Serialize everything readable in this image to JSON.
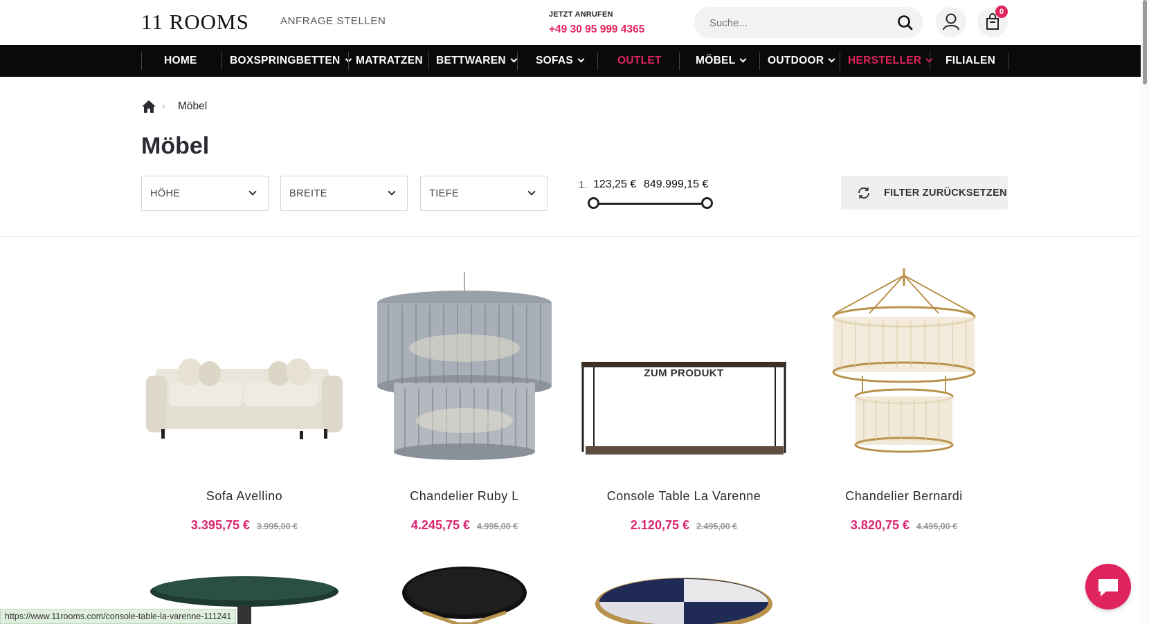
{
  "header": {
    "logo": "11 ROOMS",
    "anfrage": "ANFRAGE STELLEN",
    "call_label": "JETZT ANRUFEN",
    "call_number": "+49 30 95 999 4365",
    "search_placeholder": "Suche...",
    "cart_count": "0"
  },
  "nav": {
    "items": [
      {
        "label": "HOME"
      },
      {
        "label": "BOXSPRINGBETTEN"
      },
      {
        "label": "MATRATZEN"
      },
      {
        "label": "BETTWAREN"
      },
      {
        "label": "SOFAS"
      },
      {
        "label": "OUTLET"
      },
      {
        "label": "MÖBEL"
      },
      {
        "label": "OUTDOOR"
      },
      {
        "label": "HERSTELLER"
      },
      {
        "label": "FILIALEN"
      }
    ]
  },
  "breadcrumb": {
    "sep": "›",
    "current": "Möbel"
  },
  "page_title": "Möbel",
  "filters": {
    "hoehe": "HÖHE",
    "breite": "BREITE",
    "tiefe": "TIEFE",
    "price_prefix": "1.",
    "price_min": "123,25 €",
    "price_max": "849.999,15 €",
    "reset": "FILTER ZURÜCKSETZEN"
  },
  "products": [
    {
      "name": "Sofa Avellino",
      "price": "3.395,75 €",
      "old_price": "3.995,00 €"
    },
    {
      "name": "Chandelier Ruby L",
      "price": "4.245,75 €",
      "old_price": "4.995,00 €"
    },
    {
      "name": "Console Table La Varenne",
      "price": "2.120,75 €",
      "old_price": "2.495,00 €",
      "overlay": "ZUM PRODUKT"
    },
    {
      "name": "Chandelier Bernardi",
      "price": "3.820,75 €",
      "old_price": "4.495,00 €"
    }
  ],
  "status_url": "https://www.11rooms.com/console-table-la-varenne-111241",
  "colors": {
    "accent": "#e0245e",
    "price": "#d9266e",
    "nav_bg": "#0a0a0a"
  }
}
